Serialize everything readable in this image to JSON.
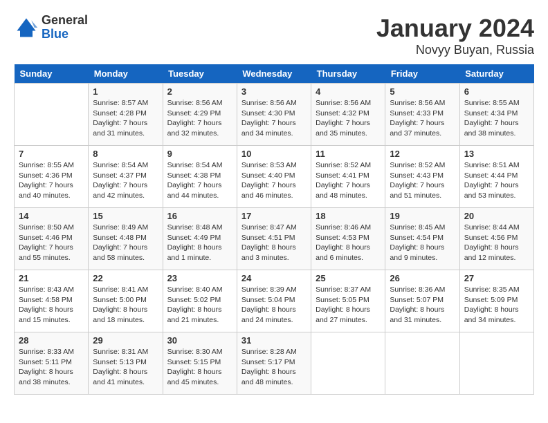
{
  "header": {
    "logo_general": "General",
    "logo_blue": "Blue",
    "title": "January 2024",
    "subtitle": "Novyy Buyan, Russia"
  },
  "days_of_week": [
    "Sunday",
    "Monday",
    "Tuesday",
    "Wednesday",
    "Thursday",
    "Friday",
    "Saturday"
  ],
  "weeks": [
    [
      {
        "day": "",
        "sunrise": "",
        "sunset": "",
        "daylight": ""
      },
      {
        "day": "1",
        "sunrise": "Sunrise: 8:57 AM",
        "sunset": "Sunset: 4:28 PM",
        "daylight": "Daylight: 7 hours and 31 minutes."
      },
      {
        "day": "2",
        "sunrise": "Sunrise: 8:56 AM",
        "sunset": "Sunset: 4:29 PM",
        "daylight": "Daylight: 7 hours and 32 minutes."
      },
      {
        "day": "3",
        "sunrise": "Sunrise: 8:56 AM",
        "sunset": "Sunset: 4:30 PM",
        "daylight": "Daylight: 7 hours and 34 minutes."
      },
      {
        "day": "4",
        "sunrise": "Sunrise: 8:56 AM",
        "sunset": "Sunset: 4:32 PM",
        "daylight": "Daylight: 7 hours and 35 minutes."
      },
      {
        "day": "5",
        "sunrise": "Sunrise: 8:56 AM",
        "sunset": "Sunset: 4:33 PM",
        "daylight": "Daylight: 7 hours and 37 minutes."
      },
      {
        "day": "6",
        "sunrise": "Sunrise: 8:55 AM",
        "sunset": "Sunset: 4:34 PM",
        "daylight": "Daylight: 7 hours and 38 minutes."
      }
    ],
    [
      {
        "day": "7",
        "sunrise": "Sunrise: 8:55 AM",
        "sunset": "Sunset: 4:36 PM",
        "daylight": "Daylight: 7 hours and 40 minutes."
      },
      {
        "day": "8",
        "sunrise": "Sunrise: 8:54 AM",
        "sunset": "Sunset: 4:37 PM",
        "daylight": "Daylight: 7 hours and 42 minutes."
      },
      {
        "day": "9",
        "sunrise": "Sunrise: 8:54 AM",
        "sunset": "Sunset: 4:38 PM",
        "daylight": "Daylight: 7 hours and 44 minutes."
      },
      {
        "day": "10",
        "sunrise": "Sunrise: 8:53 AM",
        "sunset": "Sunset: 4:40 PM",
        "daylight": "Daylight: 7 hours and 46 minutes."
      },
      {
        "day": "11",
        "sunrise": "Sunrise: 8:52 AM",
        "sunset": "Sunset: 4:41 PM",
        "daylight": "Daylight: 7 hours and 48 minutes."
      },
      {
        "day": "12",
        "sunrise": "Sunrise: 8:52 AM",
        "sunset": "Sunset: 4:43 PM",
        "daylight": "Daylight: 7 hours and 51 minutes."
      },
      {
        "day": "13",
        "sunrise": "Sunrise: 8:51 AM",
        "sunset": "Sunset: 4:44 PM",
        "daylight": "Daylight: 7 hours and 53 minutes."
      }
    ],
    [
      {
        "day": "14",
        "sunrise": "Sunrise: 8:50 AM",
        "sunset": "Sunset: 4:46 PM",
        "daylight": "Daylight: 7 hours and 55 minutes."
      },
      {
        "day": "15",
        "sunrise": "Sunrise: 8:49 AM",
        "sunset": "Sunset: 4:48 PM",
        "daylight": "Daylight: 7 hours and 58 minutes."
      },
      {
        "day": "16",
        "sunrise": "Sunrise: 8:48 AM",
        "sunset": "Sunset: 4:49 PM",
        "daylight": "Daylight: 8 hours and 1 minute."
      },
      {
        "day": "17",
        "sunrise": "Sunrise: 8:47 AM",
        "sunset": "Sunset: 4:51 PM",
        "daylight": "Daylight: 8 hours and 3 minutes."
      },
      {
        "day": "18",
        "sunrise": "Sunrise: 8:46 AM",
        "sunset": "Sunset: 4:53 PM",
        "daylight": "Daylight: 8 hours and 6 minutes."
      },
      {
        "day": "19",
        "sunrise": "Sunrise: 8:45 AM",
        "sunset": "Sunset: 4:54 PM",
        "daylight": "Daylight: 8 hours and 9 minutes."
      },
      {
        "day": "20",
        "sunrise": "Sunrise: 8:44 AM",
        "sunset": "Sunset: 4:56 PM",
        "daylight": "Daylight: 8 hours and 12 minutes."
      }
    ],
    [
      {
        "day": "21",
        "sunrise": "Sunrise: 8:43 AM",
        "sunset": "Sunset: 4:58 PM",
        "daylight": "Daylight: 8 hours and 15 minutes."
      },
      {
        "day": "22",
        "sunrise": "Sunrise: 8:41 AM",
        "sunset": "Sunset: 5:00 PM",
        "daylight": "Daylight: 8 hours and 18 minutes."
      },
      {
        "day": "23",
        "sunrise": "Sunrise: 8:40 AM",
        "sunset": "Sunset: 5:02 PM",
        "daylight": "Daylight: 8 hours and 21 minutes."
      },
      {
        "day": "24",
        "sunrise": "Sunrise: 8:39 AM",
        "sunset": "Sunset: 5:04 PM",
        "daylight": "Daylight: 8 hours and 24 minutes."
      },
      {
        "day": "25",
        "sunrise": "Sunrise: 8:37 AM",
        "sunset": "Sunset: 5:05 PM",
        "daylight": "Daylight: 8 hours and 27 minutes."
      },
      {
        "day": "26",
        "sunrise": "Sunrise: 8:36 AM",
        "sunset": "Sunset: 5:07 PM",
        "daylight": "Daylight: 8 hours and 31 minutes."
      },
      {
        "day": "27",
        "sunrise": "Sunrise: 8:35 AM",
        "sunset": "Sunset: 5:09 PM",
        "daylight": "Daylight: 8 hours and 34 minutes."
      }
    ],
    [
      {
        "day": "28",
        "sunrise": "Sunrise: 8:33 AM",
        "sunset": "Sunset: 5:11 PM",
        "daylight": "Daylight: 8 hours and 38 minutes."
      },
      {
        "day": "29",
        "sunrise": "Sunrise: 8:31 AM",
        "sunset": "Sunset: 5:13 PM",
        "daylight": "Daylight: 8 hours and 41 minutes."
      },
      {
        "day": "30",
        "sunrise": "Sunrise: 8:30 AM",
        "sunset": "Sunset: 5:15 PM",
        "daylight": "Daylight: 8 hours and 45 minutes."
      },
      {
        "day": "31",
        "sunrise": "Sunrise: 8:28 AM",
        "sunset": "Sunset: 5:17 PM",
        "daylight": "Daylight: 8 hours and 48 minutes."
      },
      {
        "day": "",
        "sunrise": "",
        "sunset": "",
        "daylight": ""
      },
      {
        "day": "",
        "sunrise": "",
        "sunset": "",
        "daylight": ""
      },
      {
        "day": "",
        "sunrise": "",
        "sunset": "",
        "daylight": ""
      }
    ]
  ]
}
